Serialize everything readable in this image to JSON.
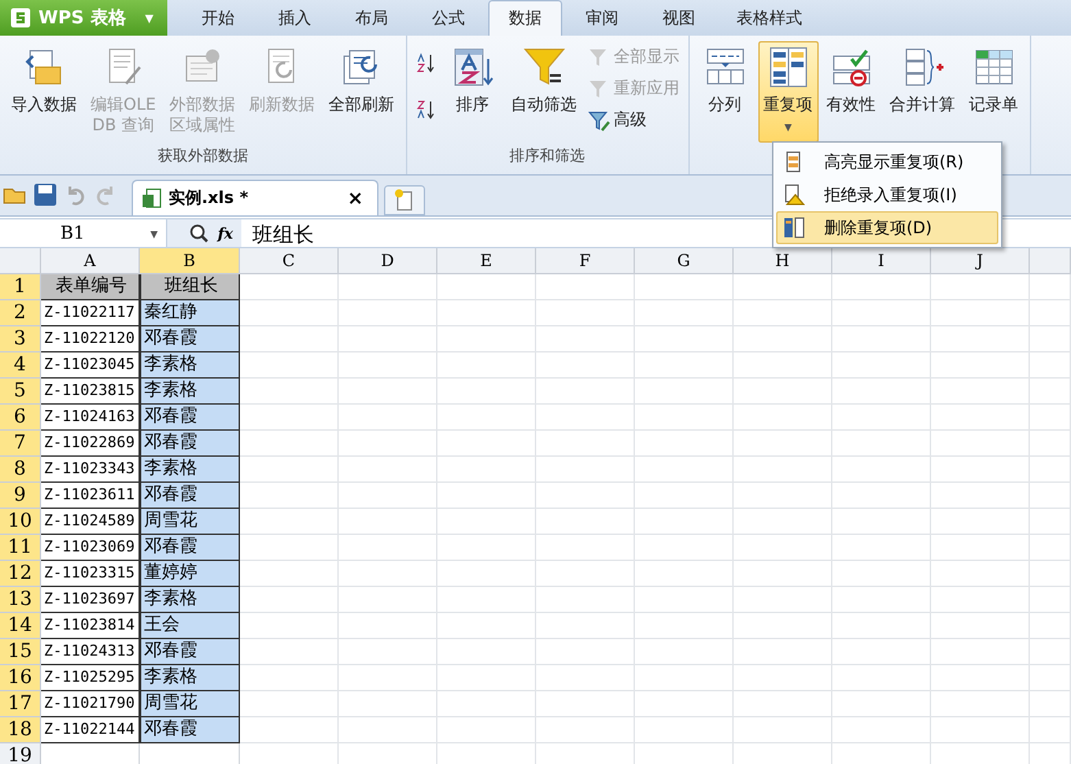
{
  "app_button": {
    "label": "WPS 表格",
    "caret": "▼"
  },
  "tabs": [
    {
      "label": "开始",
      "selected": false
    },
    {
      "label": "插入",
      "selected": false
    },
    {
      "label": "布局",
      "selected": false
    },
    {
      "label": "公式",
      "selected": false
    },
    {
      "label": "数据",
      "selected": true
    },
    {
      "label": "审阅",
      "selected": false
    },
    {
      "label": "视图",
      "selected": false
    },
    {
      "label": "表格样式",
      "selected": false
    }
  ],
  "ribbon_groups": [
    {
      "label": "获取外部数据",
      "items": [
        {
          "kind": "large",
          "lines": [
            "导入数据"
          ],
          "disabled": false,
          "pressed": false
        },
        {
          "kind": "large",
          "lines": [
            "编辑OLE",
            "DB 查询"
          ],
          "disabled": true,
          "pressed": false
        },
        {
          "kind": "large",
          "lines": [
            "外部数据",
            "区域属性"
          ],
          "disabled": true,
          "pressed": false
        },
        {
          "kind": "large",
          "lines": [
            "刷新数据"
          ],
          "disabled": true,
          "pressed": false
        },
        {
          "kind": "large",
          "lines": [
            "全部刷新"
          ],
          "disabled": false,
          "pressed": false
        }
      ]
    },
    {
      "label": "排序和筛选",
      "items": [
        {
          "kind": "sortpair"
        },
        {
          "kind": "large",
          "lines": [
            "排序"
          ],
          "disabled": false,
          "pressed": false
        },
        {
          "kind": "large",
          "lines": [
            "自动筛选"
          ],
          "disabled": false,
          "pressed": false
        },
        {
          "kind": "stack",
          "entries": [
            {
              "label": "全部显示",
              "disabled": true
            },
            {
              "label": "重新应用",
              "disabled": true
            },
            {
              "label": "高级",
              "disabled": false
            }
          ]
        }
      ]
    },
    {
      "items": [
        {
          "kind": "large",
          "lines": [
            "分列"
          ],
          "disabled": false,
          "pressed": false
        },
        {
          "kind": "large",
          "lines": [
            "重复项"
          ],
          "disabled": false,
          "pressed": true,
          "dropdown": "▼"
        },
        {
          "kind": "large",
          "lines": [
            "有效性"
          ],
          "disabled": false,
          "pressed": false
        },
        {
          "kind": "large",
          "lines": [
            "合并计算"
          ],
          "disabled": false,
          "pressed": false
        },
        {
          "kind": "large",
          "lines": [
            "记录单"
          ],
          "disabled": false,
          "pressed": false
        }
      ]
    }
  ],
  "document_tab": {
    "title": "实例.xls *",
    "close": "×"
  },
  "formula_bar": {
    "name_box": "B1",
    "name_box_caret": "▼",
    "fx": "fx",
    "value": "班组长"
  },
  "dropdown_menu": [
    {
      "label": "高亮显示重复项(R)",
      "selected": false
    },
    {
      "label": "拒绝录入重复项(I)",
      "selected": false
    },
    {
      "label": "删除重复项(D)",
      "selected": true
    }
  ],
  "columns": [
    {
      "label": "A",
      "selected": false
    },
    {
      "label": "B",
      "selected": true
    },
    {
      "label": "C",
      "selected": false
    },
    {
      "label": "D",
      "selected": false
    },
    {
      "label": "E",
      "selected": false
    },
    {
      "label": "F",
      "selected": false
    },
    {
      "label": "G",
      "selected": false
    },
    {
      "label": "H",
      "selected": false
    },
    {
      "label": "I",
      "selected": false
    },
    {
      "label": "J",
      "selected": false
    }
  ],
  "rows": [
    {
      "number": "1",
      "selected": true,
      "cells": [
        "表单编号",
        "班组长"
      ],
      "header": true
    },
    {
      "number": "2",
      "selected": true,
      "cells": [
        "Z-11022117",
        "秦红静"
      ]
    },
    {
      "number": "3",
      "selected": true,
      "cells": [
        "Z-11022120",
        "邓春霞"
      ]
    },
    {
      "number": "4",
      "selected": true,
      "cells": [
        "Z-11023045",
        "李素格"
      ]
    },
    {
      "number": "5",
      "selected": true,
      "cells": [
        "Z-11023815",
        "李素格"
      ]
    },
    {
      "number": "6",
      "selected": true,
      "cells": [
        "Z-11024163",
        "邓春霞"
      ]
    },
    {
      "number": "7",
      "selected": true,
      "cells": [
        "Z-11022869",
        "邓春霞"
      ]
    },
    {
      "number": "8",
      "selected": true,
      "cells": [
        "Z-11023343",
        "李素格"
      ]
    },
    {
      "number": "9",
      "selected": true,
      "cells": [
        "Z-11023611",
        "邓春霞"
      ]
    },
    {
      "number": "10",
      "selected": true,
      "cells": [
        "Z-11024589",
        "周雪花"
      ]
    },
    {
      "number": "11",
      "selected": true,
      "cells": [
        "Z-11023069",
        "邓春霞"
      ]
    },
    {
      "number": "12",
      "selected": true,
      "cells": [
        "Z-11023315",
        "董婷婷"
      ]
    },
    {
      "number": "13",
      "selected": true,
      "cells": [
        "Z-11023697",
        "李素格"
      ]
    },
    {
      "number": "14",
      "selected": true,
      "cells": [
        "Z-11023814",
        "王会"
      ]
    },
    {
      "number": "15",
      "selected": true,
      "cells": [
        "Z-11024313",
        "邓春霞"
      ]
    },
    {
      "number": "16",
      "selected": true,
      "cells": [
        "Z-11025295",
        "李素格"
      ]
    },
    {
      "number": "17",
      "selected": true,
      "cells": [
        "Z-11021790",
        "周雪花"
      ]
    },
    {
      "number": "18",
      "selected": true,
      "cells": [
        "Z-11022144",
        "邓春霞"
      ]
    },
    {
      "number": "19",
      "selected": false,
      "cells": [
        "",
        ""
      ]
    }
  ]
}
